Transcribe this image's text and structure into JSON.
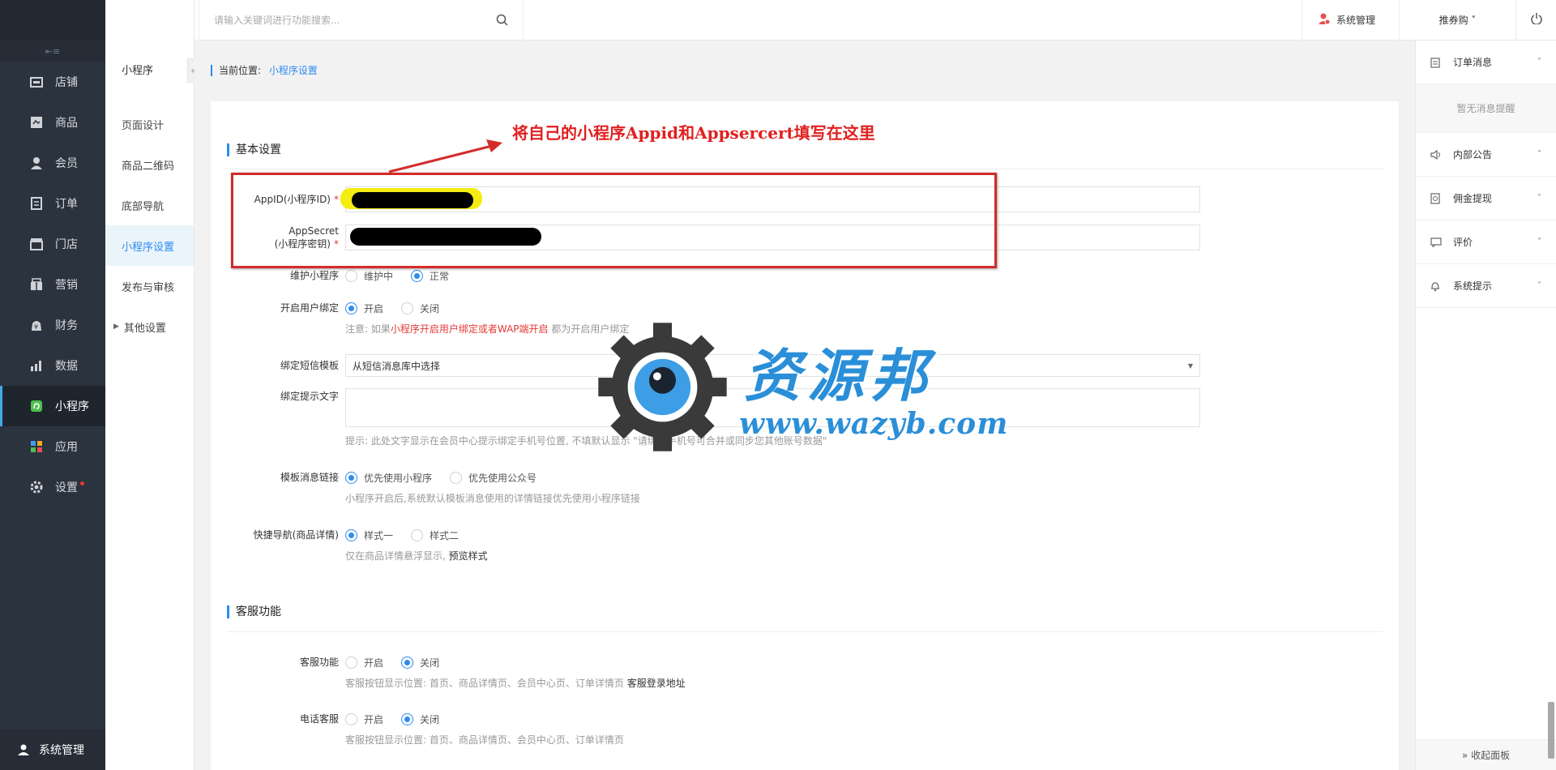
{
  "sidebar": {
    "collapse_glyph": "⇤≡",
    "items": [
      {
        "label": "店铺",
        "icon": "shop-icon"
      },
      {
        "label": "商品",
        "icon": "goods-icon"
      },
      {
        "label": "会员",
        "icon": "member-icon"
      },
      {
        "label": "订单",
        "icon": "order-icon"
      },
      {
        "label": "门店",
        "icon": "store-icon"
      },
      {
        "label": "营销",
        "icon": "marketing-icon"
      },
      {
        "label": "财务",
        "icon": "finance-icon"
      },
      {
        "label": "数据",
        "icon": "data-icon"
      },
      {
        "label": "小程序",
        "icon": "miniprogram-icon",
        "active": true
      },
      {
        "label": "应用",
        "icon": "apps-icon"
      },
      {
        "label": "设置",
        "icon": "settings-icon"
      }
    ],
    "bottom_user": "系统管理"
  },
  "subnav": {
    "title": "小程序",
    "toggle": "«",
    "items": [
      {
        "label": "页面设计"
      },
      {
        "label": "商品二维码"
      },
      {
        "label": "底部导航"
      },
      {
        "label": "小程序设置",
        "active": true
      },
      {
        "label": "发布与审核"
      },
      {
        "label": "其他设置",
        "expandable": true
      }
    ]
  },
  "header": {
    "search_placeholder": "请输入关键词进行功能搜索...",
    "system_label": "系统管理",
    "user_label": "推券购 ˅"
  },
  "right_panel": {
    "items": [
      {
        "label": "订单消息",
        "icon": "clipboard-icon"
      },
      {
        "label": "内部公告",
        "icon": "speaker-icon"
      },
      {
        "label": "佣金提现",
        "icon": "withdraw-icon"
      },
      {
        "label": "评价",
        "icon": "comment-icon"
      },
      {
        "label": "系统提示",
        "icon": "bell-icon"
      }
    ],
    "empty_text": "暂无消息提醒",
    "collapse_text": "» 收起面板"
  },
  "breadcrumb": {
    "prefix": "当前位置:",
    "current": "小程序设置"
  },
  "basic": {
    "title": "基本设置",
    "appid_label": "AppID(小程序ID)",
    "appsecret_label_1": "AppSecret",
    "appsecret_label_2": "(小程序密钥)",
    "maintain_label": "维护小程序",
    "maintain_options": [
      "维护中",
      "正常"
    ],
    "binding_label": "开启用户绑定",
    "binding_options": [
      "开启",
      "关闭"
    ],
    "binding_hint_pre": "注意: 如果",
    "binding_hint_red": "小程序开启用户绑定或者WAP端开启",
    "binding_hint_post": " 都为开启用户绑定",
    "sms_label": "绑定短信模板",
    "sms_value": "从短信消息库中选择",
    "bindtext_label": "绑定提示文字",
    "bindtext_hint": "提示: 此处文字显示在会员中心提示绑定手机号位置, 不填默认显示 \"请绑定手机号可合并或同步您其他账号数据\"",
    "tplmsg_label": "模板消息链接",
    "tplmsg_options": [
      "优先使用小程序",
      "优先使用公众号"
    ],
    "tplmsg_hint": "小程序开启后,系统默认模板消息使用的详情链接优先使用小程序链接",
    "quicknav_label": "快捷导航(商品详情)",
    "quicknav_options": [
      "样式一",
      "样式二"
    ],
    "quicknav_hint_pre": "仅在商品详情悬浮显示, ",
    "quicknav_hint_link": "预览样式"
  },
  "service": {
    "title": "客服功能",
    "cs_label": "客服功能",
    "cs_options": [
      "开启",
      "关闭"
    ],
    "cs_hint_pre": "客服按钮显示位置: 首页、商品详情页、会员中心页、订单详情页 ",
    "cs_hint_link": "客服登录地址",
    "phone_label": "电话客服",
    "phone_options": [
      "开启",
      "关闭"
    ],
    "phone_hint": "客服按钮显示位置: 首页、商品详情页、会员中心页、订单详情页"
  },
  "annotation": {
    "text": "将自己的小程序Appid和Appsercert填写在这里"
  },
  "watermark": {
    "title": "资源邦",
    "url": "www.wazyb.com"
  },
  "colors": {
    "accent": "#2d8cf0",
    "sidebar_bg": "#2b333e",
    "annotation_red": "#d52b2b",
    "watermark_blue": "#2a8fd8"
  }
}
